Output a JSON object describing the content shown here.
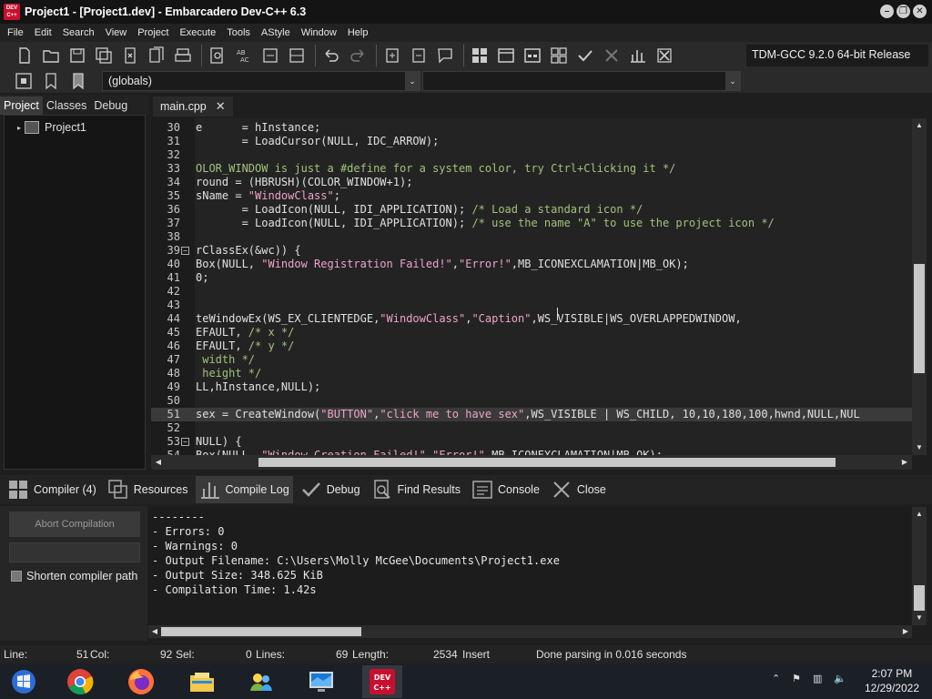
{
  "window": {
    "title": "Project1 - [Project1.dev] - Embarcadero Dev-C++ 6.3",
    "app_icon_text": "DEV C++",
    "buttons": [
      "minimize",
      "restore",
      "close"
    ]
  },
  "menu": [
    "File",
    "Edit",
    "Search",
    "View",
    "Project",
    "Execute",
    "Tools",
    "AStyle",
    "Window",
    "Help"
  ],
  "toolbar": {
    "compiler": "TDM-GCC 9.2.0 64-bit Release"
  },
  "scope_combo": {
    "value": "(globals)",
    "arrow": "⌄"
  },
  "left_panel": {
    "tabs": [
      "Project",
      "Classes",
      "Debug"
    ],
    "tree_root": "Project1"
  },
  "editor": {
    "tab": "main.cpp",
    "tab_close": "✕",
    "lines": [
      {
        "n": "30",
        "fold": "",
        "segs": [
          {
            "t": "e      = hInstance;",
            "c": "t-sym"
          }
        ]
      },
      {
        "n": "31",
        "fold": "",
        "segs": [
          {
            "t": "       = LoadCursor(NULL, IDC_ARROW);",
            "c": "t-sym"
          }
        ]
      },
      {
        "n": "32",
        "fold": "",
        "segs": []
      },
      {
        "n": "33",
        "fold": "",
        "segs": [
          {
            "t": "OLOR_WINDOW is just a #define for a system color, try Ctrl+Clicking it */",
            "c": "t-cmt"
          }
        ]
      },
      {
        "n": "34",
        "fold": "",
        "segs": [
          {
            "t": "round = (HBRUSH)(COLOR_WINDOW+1);",
            "c": "t-sym"
          }
        ]
      },
      {
        "n": "35",
        "fold": "",
        "segs": [
          {
            "t": "sName = ",
            "c": "t-sym"
          },
          {
            "t": "\"WindowClass\"",
            "c": "t-str"
          },
          {
            "t": ";",
            "c": "t-sym"
          }
        ]
      },
      {
        "n": "36",
        "fold": "",
        "segs": [
          {
            "t": "       = LoadIcon(NULL, IDI_APPLICATION); ",
            "c": "t-sym"
          },
          {
            "t": "/* Load a standard icon */",
            "c": "t-cmt"
          }
        ]
      },
      {
        "n": "37",
        "fold": "",
        "segs": [
          {
            "t": "       = LoadIcon(NULL, IDI_APPLICATION); ",
            "c": "t-sym"
          },
          {
            "t": "/* use the name \"A\" to use the project icon */",
            "c": "t-cmt"
          }
        ]
      },
      {
        "n": "38",
        "fold": "",
        "segs": []
      },
      {
        "n": "39",
        "fold": "−",
        "segs": [
          {
            "t": "rClassEx(&wc)) {",
            "c": "t-sym"
          }
        ]
      },
      {
        "n": "40",
        "fold": "",
        "segs": [
          {
            "t": "Box(NULL, ",
            "c": "t-sym"
          },
          {
            "t": "\"Window Registration Failed!\"",
            "c": "t-str"
          },
          {
            "t": ",",
            "c": "t-sym"
          },
          {
            "t": "\"Error!\"",
            "c": "t-str"
          },
          {
            "t": ",MB_ICONEXCLAMATION|MB_OK);",
            "c": "t-sym"
          }
        ]
      },
      {
        "n": "41",
        "fold": "",
        "segs": [
          {
            "t": "0;",
            "c": "t-sym"
          }
        ]
      },
      {
        "n": "42",
        "fold": "",
        "segs": []
      },
      {
        "n": "43",
        "fold": "",
        "segs": []
      },
      {
        "n": "44",
        "fold": "",
        "segs": [
          {
            "t": "teWindowEx(WS_EX_CLIENTEDGE,",
            "c": "t-sym"
          },
          {
            "t": "\"WindowClass\"",
            "c": "t-str"
          },
          {
            "t": ",",
            "c": "t-sym"
          },
          {
            "t": "\"Caption\"",
            "c": "t-str"
          },
          {
            "t": ",WS_VISIBLE|WS_OVERLAPPEDWINDOW,",
            "c": "t-sym"
          }
        ]
      },
      {
        "n": "45",
        "fold": "",
        "segs": [
          {
            "t": "EFAULT, ",
            "c": "t-sym"
          },
          {
            "t": "/* x */",
            "c": "t-cmt"
          }
        ]
      },
      {
        "n": "46",
        "fold": "",
        "segs": [
          {
            "t": "EFAULT, ",
            "c": "t-sym"
          },
          {
            "t": "/* y */",
            "c": "t-cmt"
          }
        ]
      },
      {
        "n": "47",
        "fold": "",
        "segs": [
          {
            "t": " width */",
            "c": "t-cmt"
          }
        ]
      },
      {
        "n": "48",
        "fold": "",
        "segs": [
          {
            "t": " height */",
            "c": "t-cmt"
          }
        ]
      },
      {
        "n": "49",
        "fold": "",
        "segs": [
          {
            "t": "LL,hInstance,NULL);",
            "c": "t-sym"
          }
        ]
      },
      {
        "n": "50",
        "fold": "",
        "segs": []
      },
      {
        "n": "51",
        "fold": "",
        "active": true,
        "segs": [
          {
            "t": "sex = CreateWindow(",
            "c": "t-sym"
          },
          {
            "t": "\"BUTTON\"",
            "c": "t-str"
          },
          {
            "t": ",",
            "c": "t-sym"
          },
          {
            "t": "\"click me to have sex\"",
            "c": "t-str"
          },
          {
            "t": ",WS_VISIBLE | WS_CHILD, 10,10,180,100,hwnd,NULL,NUL",
            "c": "t-sym"
          }
        ]
      },
      {
        "n": "52",
        "fold": "",
        "segs": []
      },
      {
        "n": "53",
        "fold": "−",
        "segs": [
          {
            "t": "NULL) {",
            "c": "t-sym"
          }
        ]
      },
      {
        "n": "54",
        "fold": "",
        "segs": [
          {
            "t": "Box(NULL, ",
            "c": "t-sym"
          },
          {
            "t": "\"Window Creation Failed!\"",
            "c": "t-str"
          },
          {
            "t": ",",
            "c": "t-sym"
          },
          {
            "t": "\"Error!\"",
            "c": "t-str"
          },
          {
            "t": ",MB_ICONEXCLAMATION|MB_OK);",
            "c": "t-sym"
          }
        ]
      }
    ]
  },
  "bottom": {
    "tabs": [
      {
        "label": "Compiler (4)",
        "icon": "grid-icon"
      },
      {
        "label": "Resources",
        "icon": "resources-icon"
      },
      {
        "label": "Compile Log",
        "icon": "chart-icon",
        "active": true
      },
      {
        "label": "Debug",
        "icon": "check-icon"
      },
      {
        "label": "Find Results",
        "icon": "find-icon"
      },
      {
        "label": "Console",
        "icon": "console-icon"
      },
      {
        "label": "Close",
        "icon": "close-icon"
      }
    ],
    "abort_label": "Abort Compilation",
    "shorten_label": "Shorten compiler path",
    "log": [
      "--------",
      "- Errors: 0",
      "- Warnings: 0",
      "- Output Filename: C:\\Users\\Molly McGee\\Documents\\Project1.exe",
      "- Output Size: 348.625 KiB",
      "- Compilation Time: 1.42s"
    ]
  },
  "status": {
    "line_label": "Line:",
    "line_value": "51",
    "col_label": "Col:",
    "col_value": "92",
    "sel_label": "Sel:",
    "sel_value": "0",
    "lines_label": "Lines:",
    "lines_value": "69",
    "length_label": "Length:",
    "length_value": "2534",
    "mode": "Insert",
    "message": "Done parsing in 0.016 seconds"
  },
  "taskbar": {
    "apps": [
      "windows-start",
      "chrome",
      "firefox",
      "file-explorer",
      "people-app",
      "remote-desktop",
      "dev-cpp"
    ],
    "devcpp_label": "DEV C++",
    "time": "2:07 PM",
    "date": "12/29/2022"
  }
}
